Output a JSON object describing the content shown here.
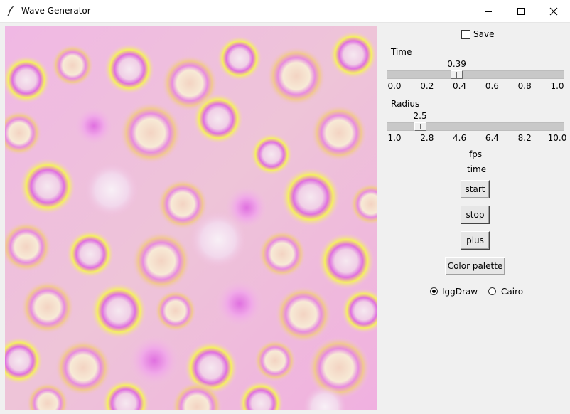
{
  "window": {
    "title": "Wave Generator",
    "icon": "feather-icon",
    "controls": [
      "minimize-icon",
      "maximize-icon",
      "close-icon"
    ]
  },
  "controls": {
    "save_label": "Save",
    "save_checked": false,
    "time": {
      "label": "Time",
      "value": "0.39",
      "fraction": 0.39,
      "ticks": [
        "0.0",
        "0.2",
        "0.4",
        "0.6",
        "0.8",
        "1.0"
      ]
    },
    "radius": {
      "label": "Radius",
      "value": "2.5",
      "fraction": 0.167,
      "ticks": [
        "1.0",
        "2.8",
        "4.6",
        "6.4",
        "8.2",
        "10.0"
      ]
    },
    "fps_label": "fps",
    "time_label": "time",
    "start_label": "start",
    "stop_label": "stop",
    "plus_label": "plus",
    "palette_label": "Color palette",
    "renderer": {
      "options": [
        "IggDraw",
        "Cairo"
      ],
      "selected": "IggDraw"
    }
  },
  "colors": {
    "accent_pink": "#e070e0",
    "yellow": "#f4f060",
    "peach": "#f0c890",
    "light": "#f6e8f0"
  }
}
